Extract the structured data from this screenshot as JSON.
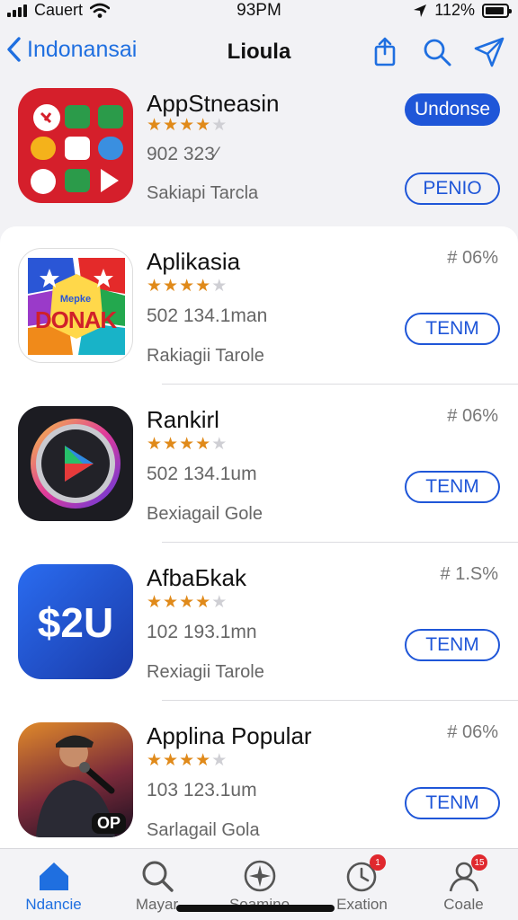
{
  "status": {
    "carrier": "Cauert",
    "time": "93PM",
    "battery": "112%",
    "battery_fill": 0.9
  },
  "nav": {
    "back_label": "Indonansai",
    "title": "Lioula"
  },
  "featured": {
    "name": "AppStneasin",
    "rating": 4,
    "meta": "902 323⁄",
    "sub": "Sakiapi Tarcla",
    "primary_button": "Undonse",
    "secondary_button": "PENIO"
  },
  "apps": [
    {
      "name": "Aplikasia",
      "rating": 3.5,
      "meta": "502 134.1man",
      "sub": "Rakiagii Tarole",
      "pct": "# 06%",
      "button": "TENM",
      "icon_text": "DONAK",
      "icon_small": "Mepke"
    },
    {
      "name": "Rankirl",
      "rating": 3.5,
      "meta": "502 134.1um",
      "sub": "Bexiagail Gole",
      "pct": "# 06%",
      "button": "TENM"
    },
    {
      "name": "AfbaБkak",
      "rating": 3.5,
      "meta": "102 193.1mn",
      "sub": "Rexiagii Tarole",
      "pct": "# 1.S%",
      "button": "TENM",
      "icon_text": "$2U"
    },
    {
      "name": "Applina Popular",
      "rating": 3.5,
      "meta": "103 123.1um",
      "sub": "Sarlagail Gola",
      "pct": "# 06%",
      "button": "TENM",
      "icon_text": "OP"
    }
  ],
  "tabs": [
    {
      "label": "Ndancie",
      "icon": "home-icon",
      "active": true
    },
    {
      "label": "Mayar",
      "icon": "search-icon"
    },
    {
      "label": "Soamino",
      "icon": "compass-icon"
    },
    {
      "label": "Exation",
      "icon": "clock-icon",
      "badge": "1"
    },
    {
      "label": "Coale",
      "icon": "person-icon",
      "badge": "15"
    }
  ],
  "colors": {
    "accent": "#1f56d8",
    "link": "#1f6fe0",
    "star": "#e08a1a"
  }
}
